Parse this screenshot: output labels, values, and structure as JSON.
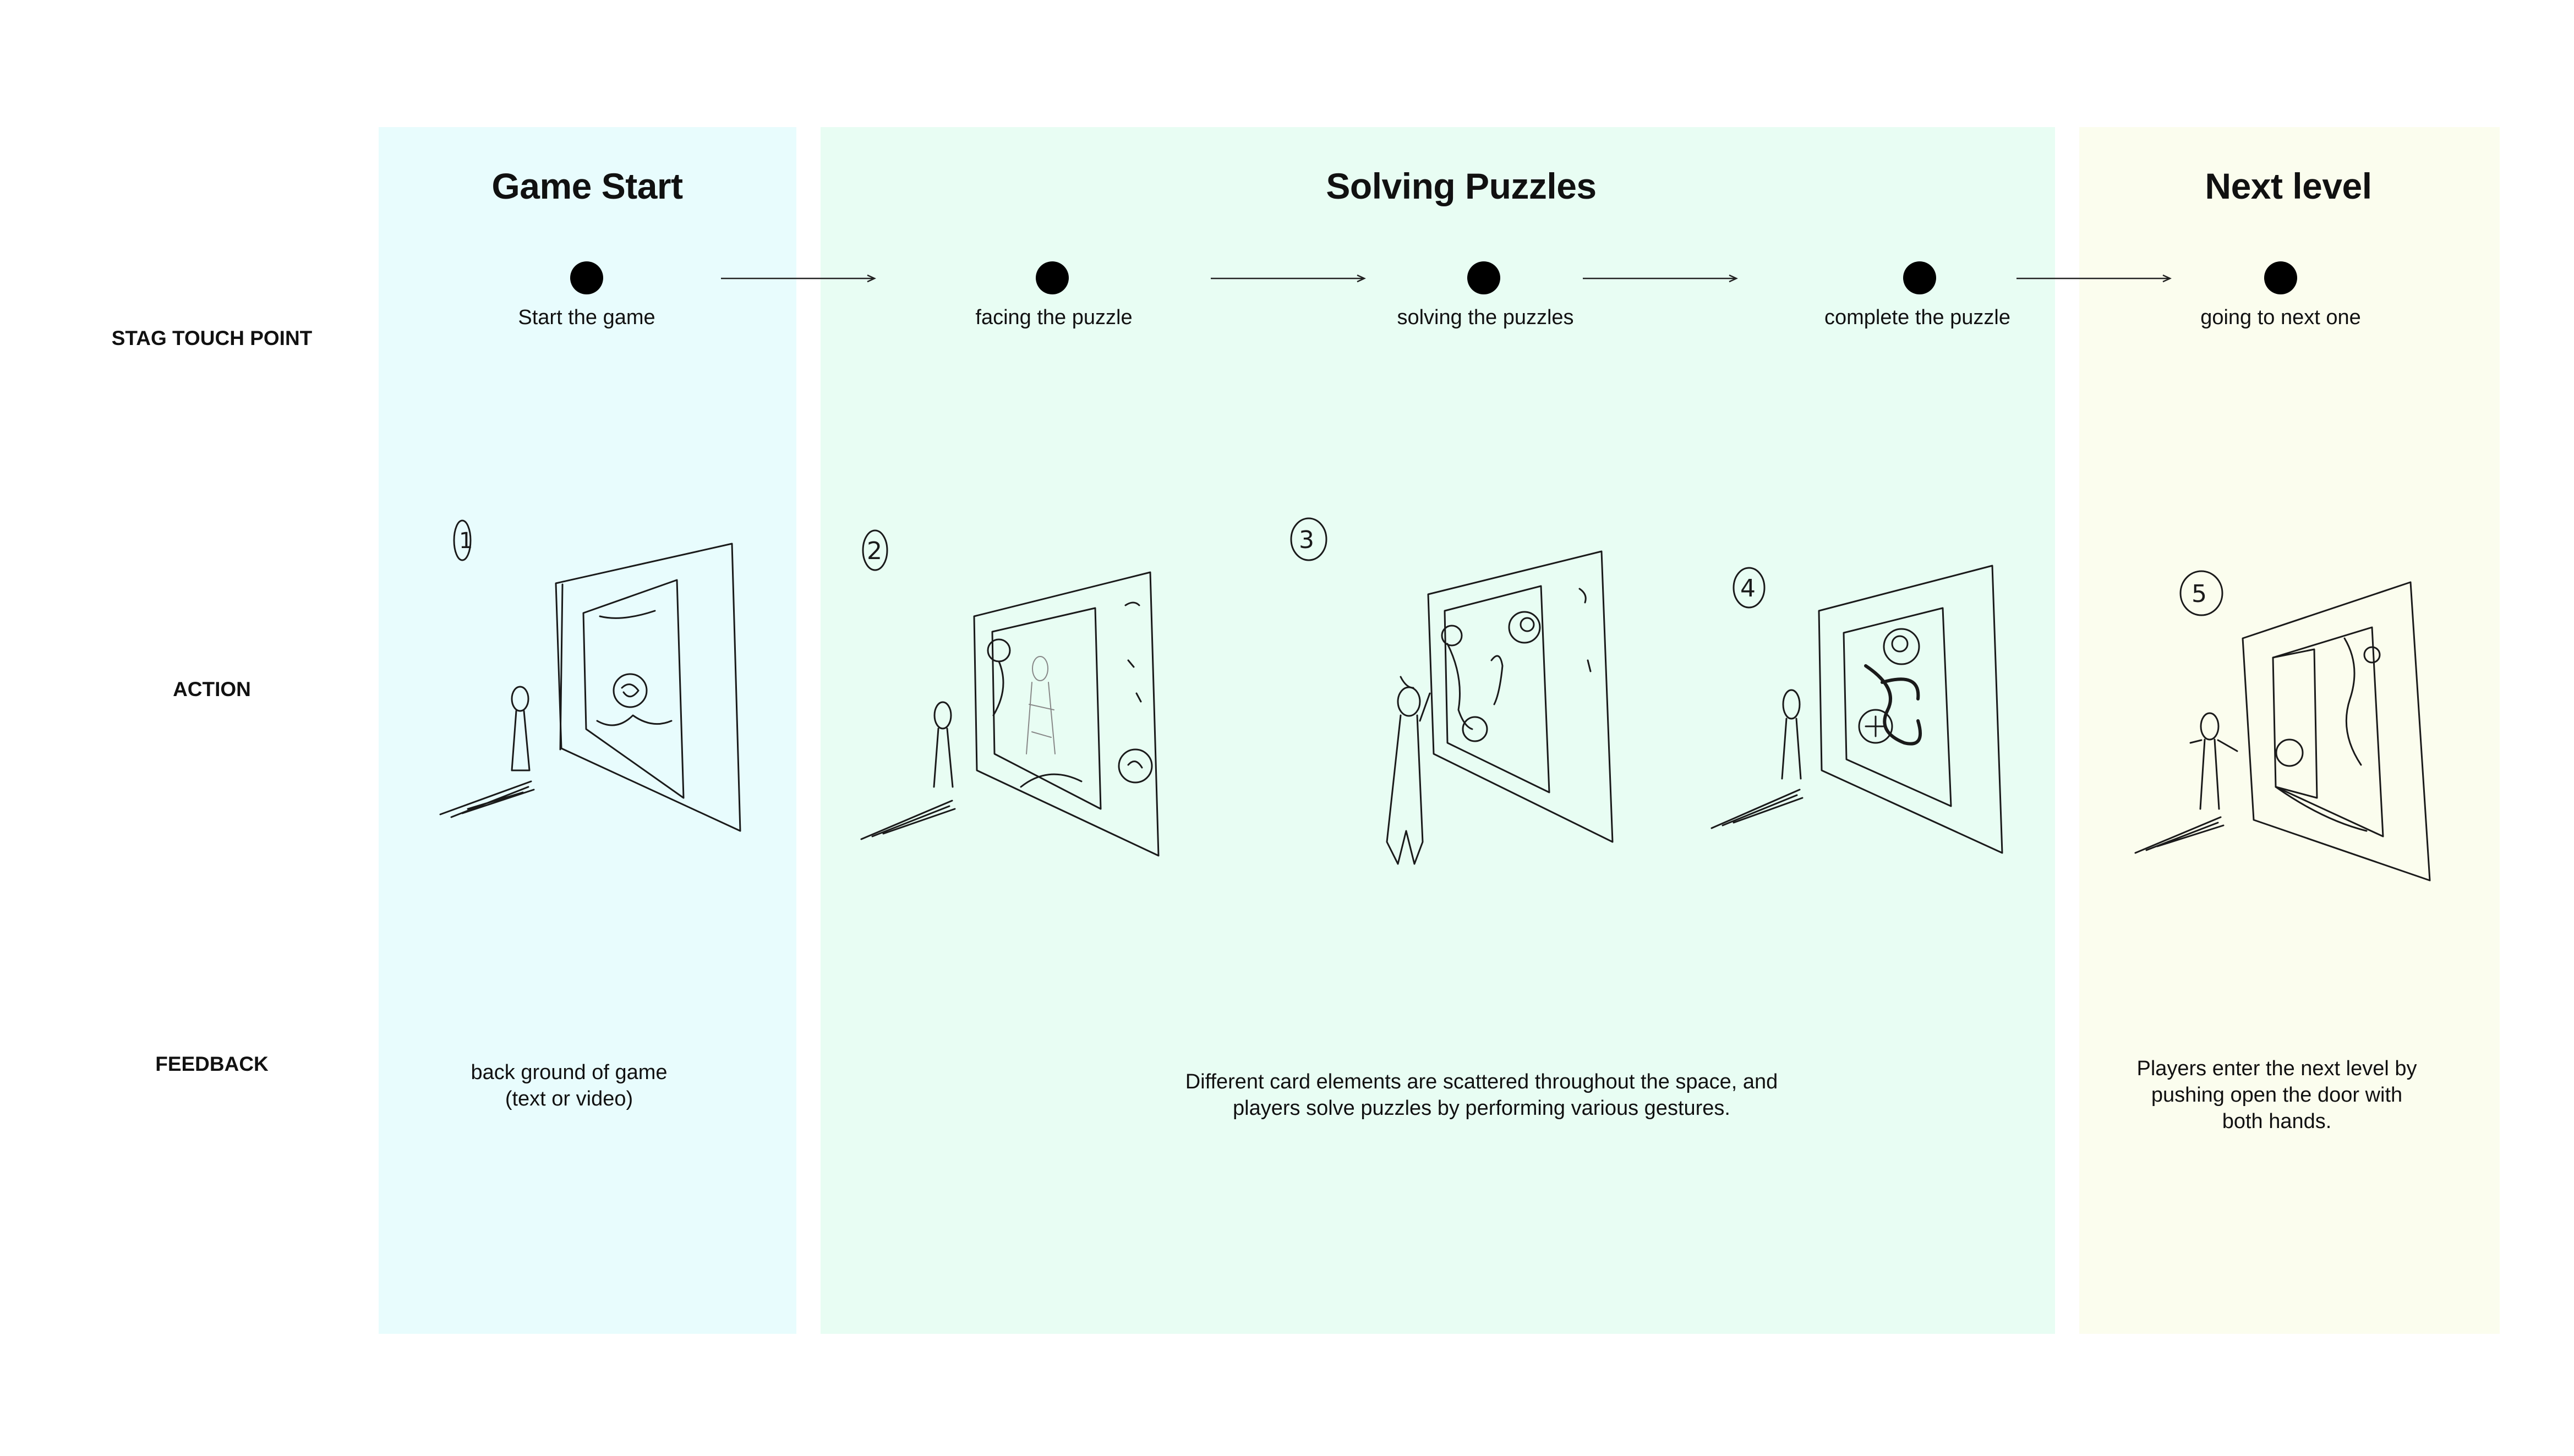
{
  "stages": {
    "game_start": "Game Start",
    "solving_puzzles": "Solving Puzzles",
    "next_level": "Next level"
  },
  "rows": {
    "touch_point": "STAG TOUCH POINT",
    "action": "ACTION",
    "feedback": "FEEDBACK"
  },
  "touch_points": [
    "Start the game",
    "facing the puzzle",
    "solving the puzzles",
    "complete the puzzle",
    "going to next one"
  ],
  "sketch_numbers": [
    "1",
    "2",
    "3",
    "4",
    "5"
  ],
  "feedback": {
    "game_start": [
      "back ground of game",
      "(text or video)"
    ],
    "solving_puzzles": [
      "Different card elements are scattered throughout the space, and",
      "players solve puzzles by performing various gestures."
    ],
    "next_level": [
      "Players enter the next level by",
      "pushing open the door with",
      "both hands."
    ]
  },
  "colors": {
    "game_start_bg": "#e8fcfd",
    "solving_puzzles_bg": "#e8fdf3",
    "next_level_bg": "#fbfdee"
  }
}
